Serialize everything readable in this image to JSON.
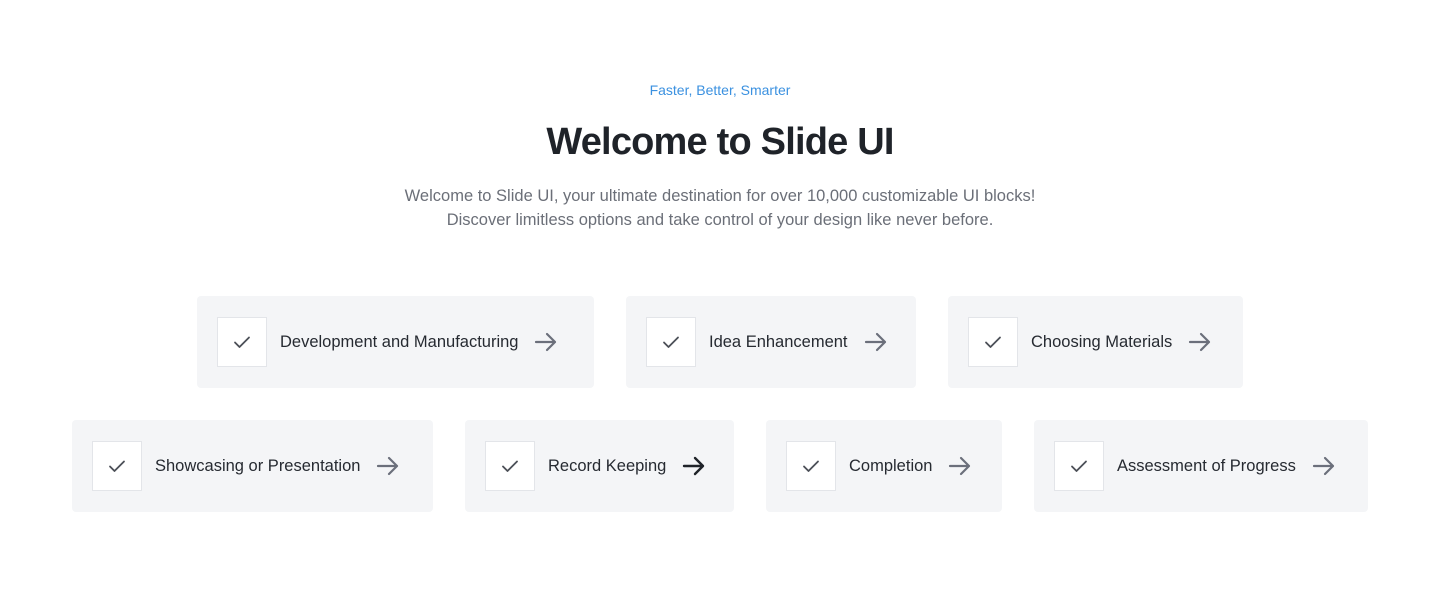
{
  "hero": {
    "eyebrow": "Faster, Better, Smarter",
    "title": "Welcome to Slide UI",
    "subtitle": "Welcome to Slide UI, your ultimate destination for over 10,000 customizable UI blocks! Discover limitless options and take control of your design like never before."
  },
  "features": {
    "row1": [
      {
        "label": "Development and Manufacturing",
        "icon": "check-icon",
        "arrow": "arrow-right-icon"
      },
      {
        "label": "Idea Enhancement",
        "icon": "check-icon",
        "arrow": "arrow-right-icon"
      },
      {
        "label": "Choosing Materials",
        "icon": "check-icon",
        "arrow": "arrow-right-icon"
      }
    ],
    "row2": [
      {
        "label": "Showcasing or Presentation",
        "icon": "check-icon",
        "arrow": "arrow-right-icon"
      },
      {
        "label": "Record Keeping",
        "icon": "check-icon",
        "arrow": "arrow-right-icon",
        "active": true
      },
      {
        "label": "Completion",
        "icon": "check-icon",
        "arrow": "arrow-right-icon"
      },
      {
        "label": "Assessment of Progress",
        "icon": "check-icon",
        "arrow": "arrow-right-icon"
      }
    ]
  },
  "colors": {
    "accent": "#3b91e0",
    "title": "#1f2329",
    "body_text": "#6b6f78",
    "card_background": "#f4f5f7",
    "arrow": "#6b6f7b",
    "arrow_active": "#1f2329"
  }
}
